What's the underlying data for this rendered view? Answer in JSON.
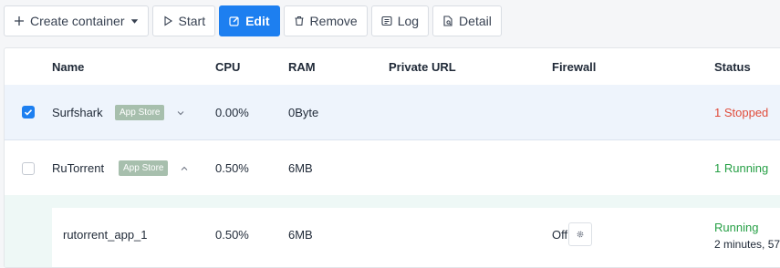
{
  "toolbar": {
    "create_label": "Create container",
    "start_label": "Start",
    "edit_label": "Edit",
    "remove_label": "Remove",
    "log_label": "Log",
    "detail_label": "Detail"
  },
  "table": {
    "headers": {
      "name": "Name",
      "cpu": "CPU",
      "ram": "RAM",
      "private_url": "Private URL",
      "firewall": "Firewall",
      "status": "Status"
    },
    "rows": [
      {
        "name": "Surfshark",
        "tag": "App Store",
        "cpu": "0.00%",
        "ram": "0Byte",
        "status": "1 Stopped",
        "checked": true,
        "expanded": false
      },
      {
        "name": "RuTorrent",
        "tag": "App Store",
        "cpu": "0.50%",
        "ram": "6MB",
        "status": "1 Running",
        "checked": false,
        "expanded": true,
        "children": [
          {
            "name": "rutorrent_app_1",
            "cpu": "0.50%",
            "ram": "6MB",
            "firewall": "Off",
            "status": "Running",
            "uptime": "2 minutes, 57"
          }
        ]
      }
    ]
  },
  "colors": {
    "primary": "#1d7ff0",
    "stopped": "#e04b3a",
    "running": "#27a046",
    "tag": "#a7bfad"
  }
}
